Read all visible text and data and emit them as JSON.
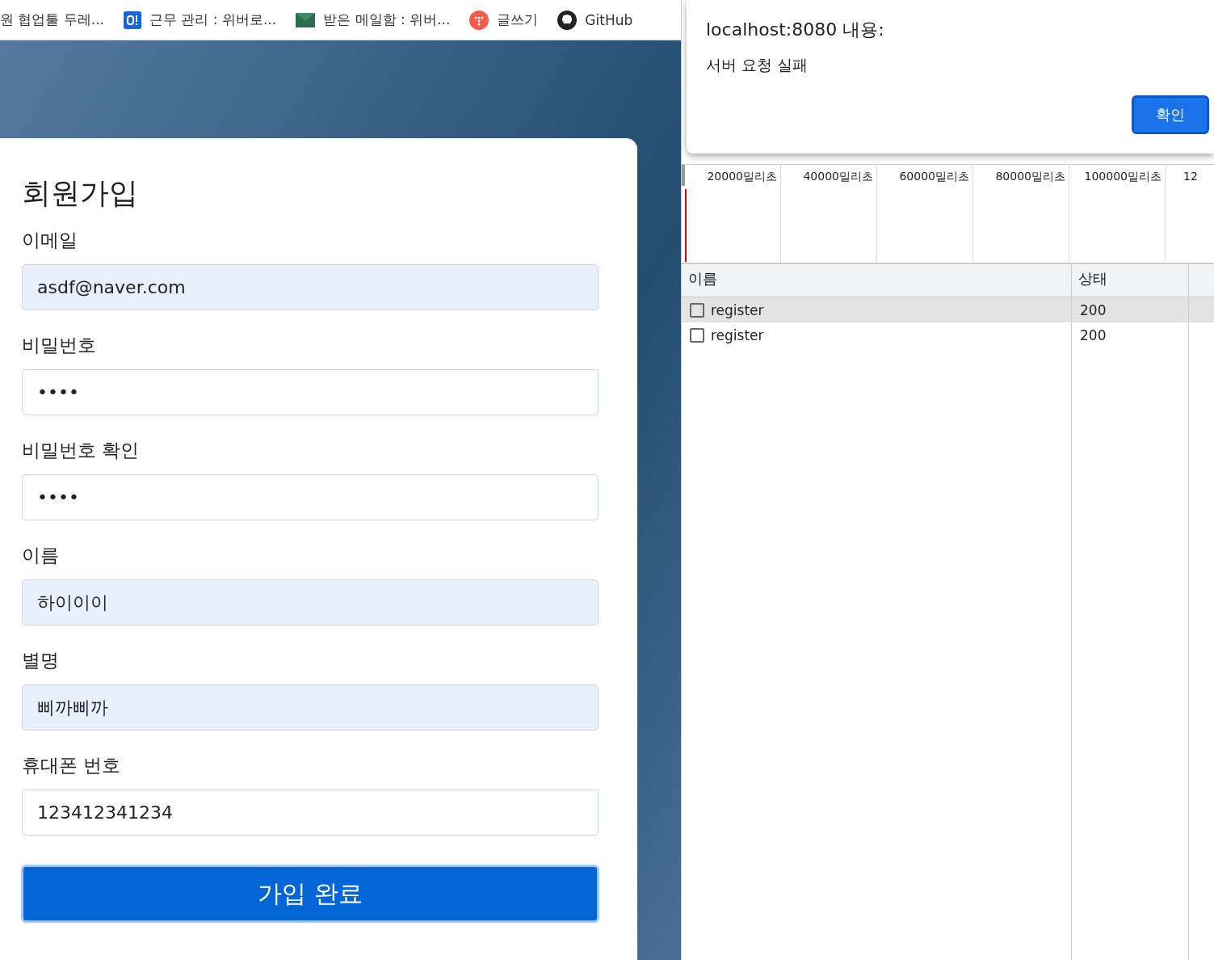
{
  "bookmarks": [
    {
      "label": "원 협업툴 두레..."
    },
    {
      "label": "근무 관리 : 위버로..."
    },
    {
      "label": "받은 메일함 : 위버..."
    },
    {
      "label": "글쓰기"
    },
    {
      "label": "GitHub"
    }
  ],
  "form": {
    "title": "회원가입",
    "fields": [
      {
        "label": "이메일",
        "value": "asdf@naver.com",
        "autofilled": true
      },
      {
        "label": "비밀번호",
        "value": "••••",
        "autofilled": false
      },
      {
        "label": "비밀번호 확인",
        "value": "••••",
        "autofilled": false
      },
      {
        "label": "이름",
        "value": "하이이이",
        "autofilled": true
      },
      {
        "label": "별명",
        "value": "삐까삐까",
        "autofilled": true
      },
      {
        "label": "휴대폰 번호",
        "value": "123412341234",
        "autofilled": false
      }
    ],
    "submit": "가입 완료"
  },
  "devtools": {
    "timeline_ticks": [
      "20000밀리초",
      "40000밀리초",
      "60000밀리초",
      "80000밀리초",
      "100000밀리초",
      "12"
    ],
    "columns": [
      "이름",
      "상태"
    ],
    "rows": [
      {
        "name": "register",
        "status": "200",
        "selected": true,
        "checked": false
      },
      {
        "name": "register",
        "status": "200",
        "selected": false,
        "checked": false
      }
    ]
  },
  "dialog": {
    "title": "localhost:8080 내용:",
    "message": "서버 요청 실패",
    "button": "확인"
  }
}
